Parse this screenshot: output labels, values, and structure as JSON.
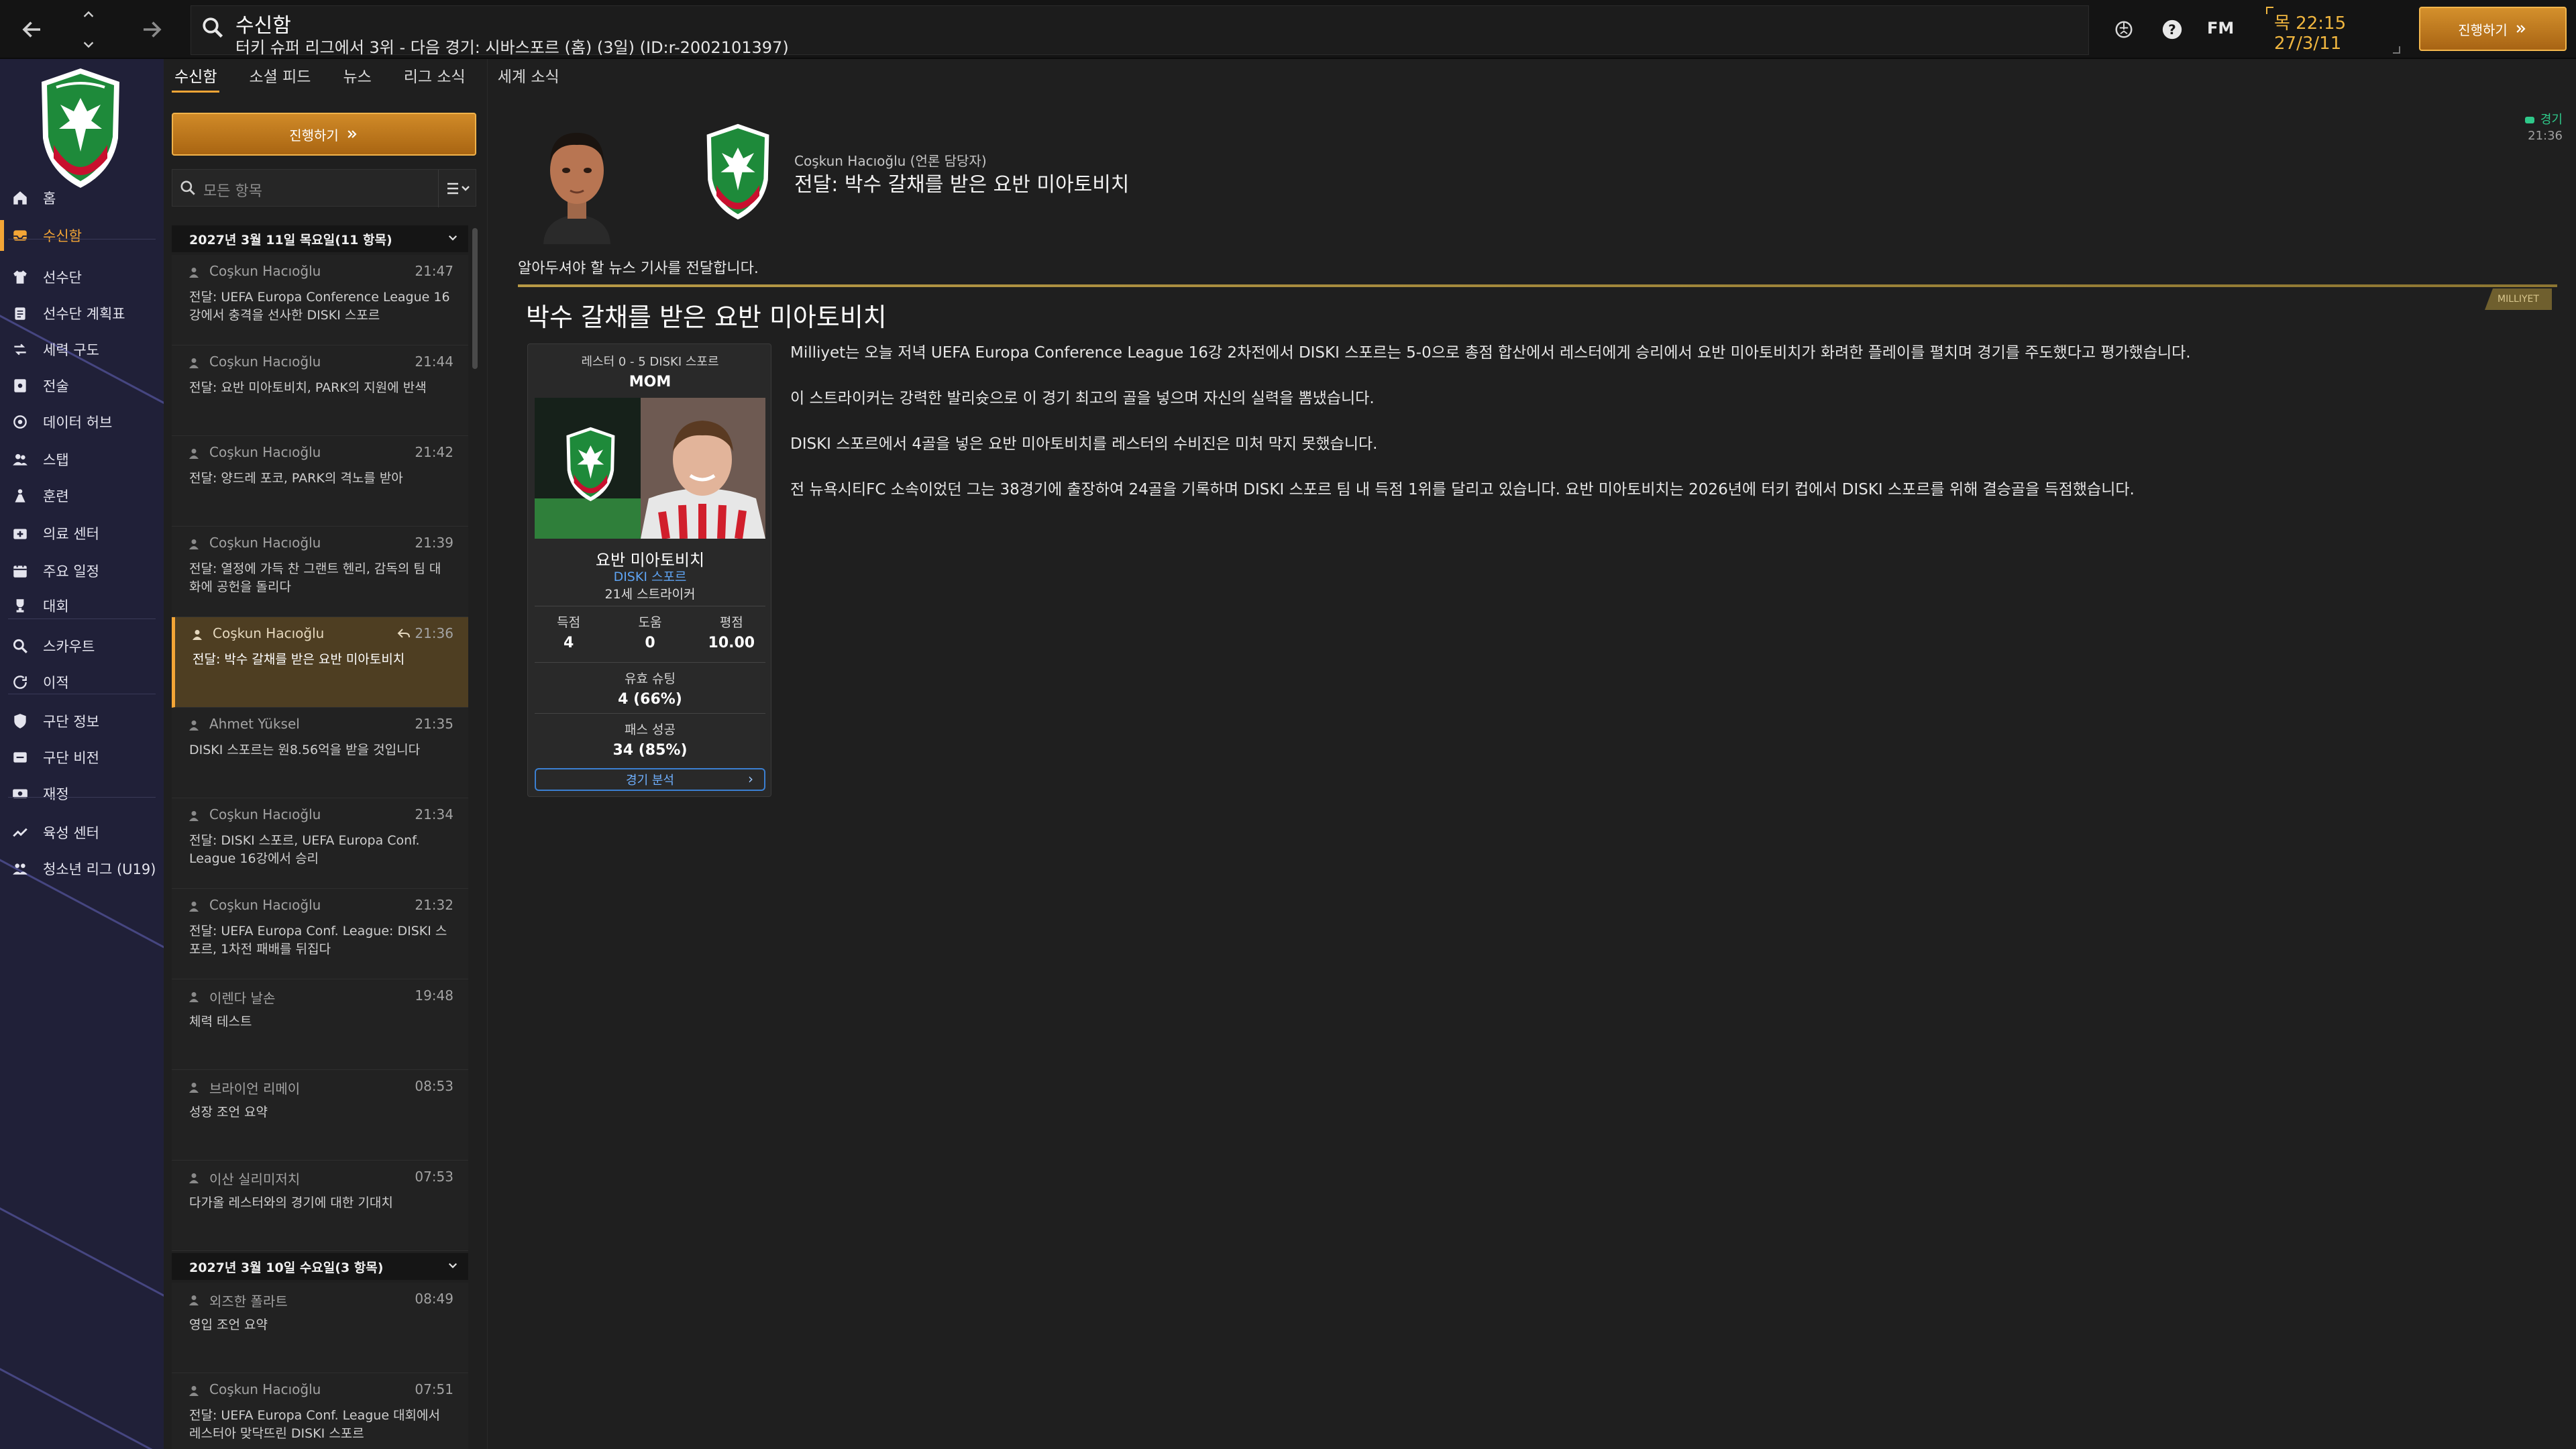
{
  "topbar": {
    "title": "수신함",
    "subtitle": "터키 슈퍼 리그에서 3위 - 다음 경기: 시바스포르 (홈) (3일) (ID:r-2002101397)",
    "fm_logo": "FM",
    "time": "목 22:15",
    "date": "27/3/11",
    "continue_label": "진행하기"
  },
  "sidebar": {
    "items": [
      {
        "label": "홈",
        "icon": "home-icon"
      },
      {
        "label": "수신함",
        "icon": "inbox-icon",
        "active": true
      },
      {
        "label": "선수단",
        "icon": "shirt-icon"
      },
      {
        "label": "선수단 계획표",
        "icon": "clipboard-icon"
      },
      {
        "label": "세력 구도",
        "icon": "dynamics-icon"
      },
      {
        "label": "전술",
        "icon": "tactics-icon"
      },
      {
        "label": "데이터 허브",
        "icon": "data-hub-icon"
      },
      {
        "label": "스탭",
        "icon": "staff-icon"
      },
      {
        "label": "훈련",
        "icon": "training-icon"
      },
      {
        "label": "의료 센터",
        "icon": "medical-icon"
      },
      {
        "label": "주요 일정",
        "icon": "calendar-icon"
      },
      {
        "label": "대회",
        "icon": "trophy-icon"
      },
      {
        "label": "스카우트",
        "icon": "scout-icon"
      },
      {
        "label": "이적",
        "icon": "transfer-icon"
      },
      {
        "label": "구단 정보",
        "icon": "club-info-icon"
      },
      {
        "label": "구단 비전",
        "icon": "vision-icon"
      },
      {
        "label": "재정",
        "icon": "finance-icon"
      },
      {
        "label": "육성 센터",
        "icon": "development-icon"
      },
      {
        "label": "청소년 리그 (U19)",
        "icon": "youth-icon"
      }
    ]
  },
  "tabs": [
    "수신함",
    "소셜 피드",
    "뉴스",
    "리그 소식",
    "세계 소식"
  ],
  "inbox": {
    "continue_label": "진행하기",
    "filter_placeholder": "모든 항목",
    "groups": [
      {
        "label": "2027년 3월 11일 목요일(11 항목)"
      },
      {
        "label": "2027년 3월 10일 수요일(3 항목)"
      }
    ],
    "messages": [
      {
        "from": "Coşkun Hacıoğlu",
        "time": "21:47",
        "subject": "전달: UEFA Europa Conference League 16강에서 충격을 선사한 DISKI 스포르"
      },
      {
        "from": "Coşkun Hacıoğlu",
        "time": "21:44",
        "subject": "전달: 요반 미아토비치, PARK의 지원에 반색"
      },
      {
        "from": "Coşkun Hacıoğlu",
        "time": "21:42",
        "subject": "전달: 양드레 포코, PARK의 격노를 받아"
      },
      {
        "from": "Coşkun Hacıoğlu",
        "time": "21:39",
        "subject": "전달: 열정에 가득 찬 그랜트 헨리, 감독의 팀 대화에 공헌을 돌리다"
      },
      {
        "from": "Coşkun Hacıoğlu",
        "time": "21:36",
        "subject": "전달: 박수 갈채를 받은 요반 미아토비치",
        "selected": true
      },
      {
        "from": "Ahmet Yüksel",
        "time": "21:35",
        "subject": "DISKI 스포르는 원8.56억을 받을 것입니다"
      },
      {
        "from": "Coşkun Hacıoğlu",
        "time": "21:34",
        "subject": "전달: DISKI 스포르, UEFA Europa Conf. League 16강에서 승리"
      },
      {
        "from": "Coşkun Hacıoğlu",
        "time": "21:32",
        "subject": "전달: UEFA Europa Conf. League: DISKI 스포르, 1차전 패배를 뒤집다"
      },
      {
        "from": "이렌다 날손",
        "time": "19:48",
        "subject": "체력 테스트"
      },
      {
        "from": "브라이언 리메이",
        "time": "08:53",
        "subject": "성장 조언 요약"
      },
      {
        "from": "이산 실리미저치",
        "time": "07:53",
        "subject": "다가올 레스터와의 경기에 대한 기대치"
      },
      {
        "from": "외즈한 폴라트",
        "time": "08:49",
        "subject": "영입 조언 요약"
      },
      {
        "from": "Coşkun Hacıoğlu",
        "time": "07:51",
        "subject": "전달: UEFA Europa Conf. League 대회에서 레스터아 맞닥뜨린 DISKI 스포르"
      }
    ]
  },
  "detail": {
    "status": "경기",
    "status_time": "21:36",
    "sender_name": "Coşkun Hacıoğlu (언론 담당자)",
    "sender_subject": "전달: 박수 갈채를 받은 요반 미아토비치",
    "intro": "알아두셔야 할 뉴스 기사를 전달합니다.",
    "source_tag": "MILLIYET",
    "headline": "박수 갈채를 받은 요반 미아토비치",
    "card": {
      "score": "레스터 0 - 5 DISKI 스포르",
      "mom": "MOM",
      "player_name": "요반 미아토비치",
      "club": "DISKI 스포르",
      "role": "21세 스트라이커",
      "stats": [
        {
          "label": "득점",
          "value": "4"
        },
        {
          "label": "도움",
          "value": "0"
        },
        {
          "label": "평점",
          "value": "10.00"
        }
      ],
      "shots_label": "유효 슈팅",
      "shots_value": "4 (66%)",
      "passes_label": "패스 성공",
      "passes_value": "34 (85%)",
      "analysis_label": "경기 분석"
    },
    "paragraphs": [
      "Milliyet는 오늘 저녁 UEFA Europa Conference League 16강 2차전에서 DISKI 스포르는 5-0으로 총점 합산에서 레스터에게 승리에서 요반 미아토비치가 화려한 플레이를 펼치며 경기를 주도했다고 평가했습니다.",
      "이 스트라이커는 강력한 발리슛으로 이 경기 최고의 골을 넣으며 자신의 실력을 뽐냈습니다.",
      "DISKI 스포르에서 4골을 넣은 요반 미아토비치를 레스터의 수비진은 미처 막지 못했습니다.",
      "전 뉴욕시티FC 소속이었던 그는 38경기에 출장하여 24골을 기록하며 DISKI 스포르 팀 내 득점 1위를 달리고 있습니다. 요반 미아토비치는 2026년에 터키 컵에서 DISKI 스포르를 위해 결승골을 득점했습니다."
    ]
  },
  "colors": {
    "accent": "#f3a536",
    "sidebar_bg": "#202038",
    "selected_msg_bg": "#4e3e22",
    "link_blue": "#5ea3f2"
  }
}
